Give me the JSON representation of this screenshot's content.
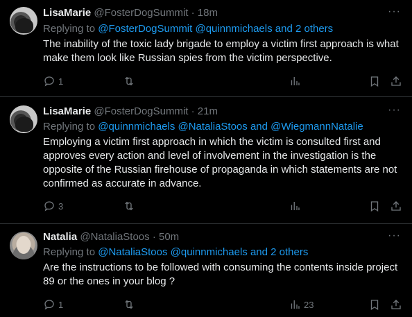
{
  "tweets": [
    {
      "name": "LisaMarie",
      "handle": "@FosterDogSummit",
      "time": "· 18m",
      "reply_prefix": "Replying to ",
      "reply_links": "@FosterDogSummit @quinnmichaels and 2 others",
      "text": "The inability of the toxic lady brigade to employ a victim first approach is what make them look like Russian spies from the victim perspective.",
      "reply_count": "1",
      "retweet_count": "",
      "views": ""
    },
    {
      "name": "LisaMarie",
      "handle": "@FosterDogSummit",
      "time": "· 21m",
      "reply_prefix": "Replying to ",
      "reply_links": "@quinnmichaels @NataliaStoos and @WiegmannNatalie",
      "text": "Employing a victim first approach in which the victim is consulted first and approves every action and level of involvement in the investigation is the opposite of the Russian firehouse of propaganda in which statements are not confirmed as accurate in advance.",
      "reply_count": "3",
      "retweet_count": "",
      "views": ""
    },
    {
      "name": "Natalia",
      "handle": "@NataliaStoos",
      "time": "· 50m",
      "reply_prefix": "Replying to ",
      "reply_links": "@NataliaStoos @quinnmichaels and 2 others",
      "text": "Are the instructions to be followed with consuming  the contents inside project 89   or the ones in your blog ?",
      "reply_count": "1",
      "retweet_count": "",
      "views": "23"
    }
  ],
  "icons": {
    "more": "more-horizontal-icon",
    "reply": "speech-bubble-icon",
    "retweet": "retweet-icon",
    "views": "bar-chart-icon",
    "bookmark": "bookmark-icon",
    "share": "share-upload-icon"
  },
  "colors": {
    "background": "#000000",
    "text": "#e7e9ea",
    "muted": "#71767b",
    "link": "#1d9bf0",
    "divider": "#2f3336"
  }
}
